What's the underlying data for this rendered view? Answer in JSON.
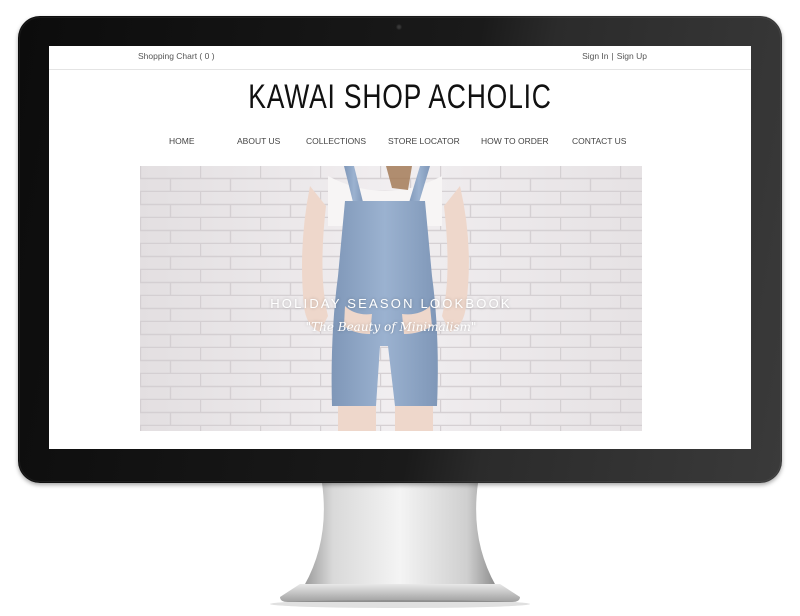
{
  "topbar": {
    "cart_label": "Shopping Chart ( 0 )",
    "sign_in": "Sign In",
    "separator": "|",
    "sign_up": "Sign Up"
  },
  "logo": {
    "text": "KAWAI SHOP ACHOLIC"
  },
  "nav": {
    "items": [
      {
        "label": "HOME"
      },
      {
        "label": "ABOUT US"
      },
      {
        "label": "COLLECTIONS"
      },
      {
        "label": "STORE LOCATOR"
      },
      {
        "label": "HOW TO ORDER"
      },
      {
        "label": "CONTACT US"
      }
    ]
  },
  "hero": {
    "title": "HOLIDAY SEASON LOOKBOOK",
    "subtitle": "\"The Beauty of Minimalism\""
  },
  "colors": {
    "bezel": "#111111",
    "page_background": "#ffffff",
    "text_dark": "#111111",
    "nav_text": "#444444",
    "hero_overalls": "#8fa8c8",
    "hero_wall": "#ece9ea"
  },
  "icons": {
    "camera": "webcam-dot-icon"
  }
}
